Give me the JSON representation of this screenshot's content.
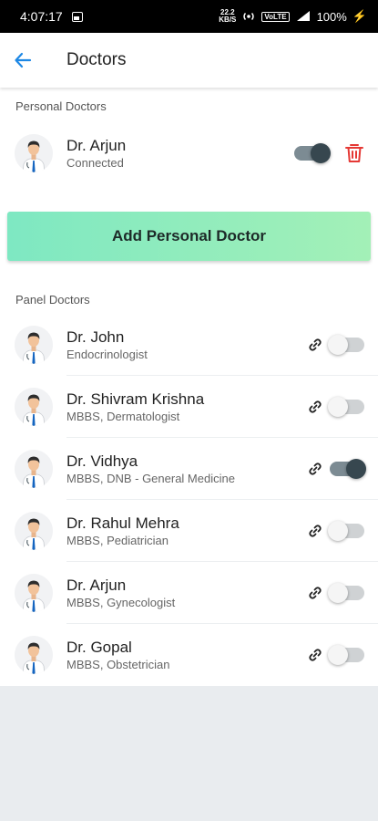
{
  "status_bar": {
    "time": "4:07:17",
    "speed_value": "22.2",
    "speed_unit": "KB/S",
    "network_label": "VoLTE",
    "battery": "100%"
  },
  "app_bar": {
    "title": "Doctors",
    "back_icon": "arrow-back-icon"
  },
  "personal": {
    "section_label": "Personal Doctors",
    "doctors": [
      {
        "name": "Dr. Arjun",
        "subtitle": "Connected",
        "enabled": true
      }
    ],
    "add_button_label": "Add Personal Doctor"
  },
  "panel": {
    "section_label": "Panel Doctors",
    "doctors": [
      {
        "name": "Dr. John",
        "subtitle": "Endocrinologist",
        "enabled": false
      },
      {
        "name": "Dr. Shivram Krishna",
        "subtitle": "MBBS, Dermatologist",
        "enabled": false
      },
      {
        "name": "Dr. Vidhya",
        "subtitle": "MBBS, DNB - General Medicine",
        "enabled": true
      },
      {
        "name": "Dr. Rahul Mehra",
        "subtitle": "MBBS, Pediatrician",
        "enabled": false
      },
      {
        "name": "Dr. Arjun",
        "subtitle": "MBBS, Gynecologist",
        "enabled": false
      },
      {
        "name": "Dr. Gopal",
        "subtitle": "MBBS, Obstetrician",
        "enabled": false
      }
    ]
  },
  "colors": {
    "accent_blue": "#1e88e5",
    "delete_red": "#e53935",
    "toggle_on": "#37474f",
    "button_gradient_start": "#7ee8c2",
    "button_gradient_end": "#a3f0b7"
  }
}
